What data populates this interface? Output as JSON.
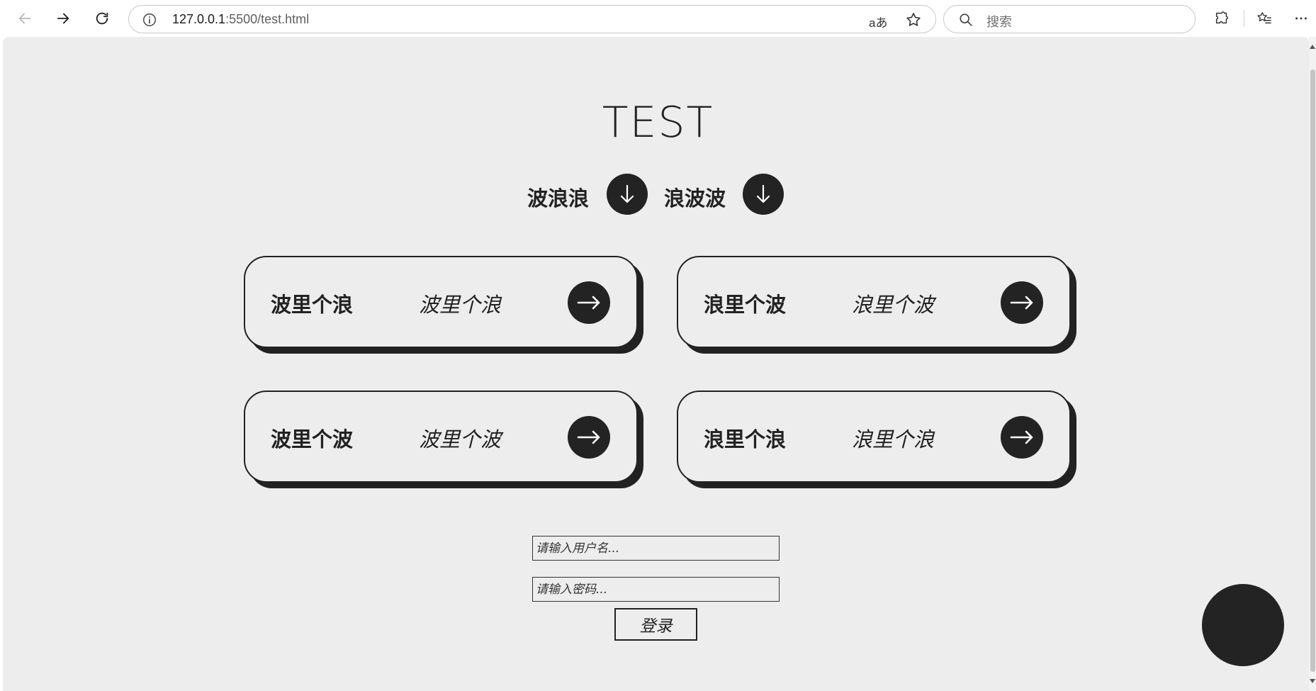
{
  "browser": {
    "url_host": "127.0.0.1",
    "url_rest": ":5500/test.html",
    "read_aloud_label": "aあ",
    "search_placeholder": "搜索"
  },
  "page": {
    "title": "TEST",
    "wave_buttons": [
      {
        "label": "波浪浪",
        "icon": "arrow-down-icon"
      },
      {
        "label": "浪波波",
        "icon": "arrow-down-icon"
      }
    ],
    "cards": [
      {
        "bold": "波里个浪",
        "italic": "波里个浪",
        "icon": "arrow-right-icon"
      },
      {
        "bold": "浪里个波",
        "italic": "浪里个波",
        "icon": "arrow-right-icon"
      },
      {
        "bold": "波里个波",
        "italic": "波里个波",
        "icon": "arrow-right-icon"
      },
      {
        "bold": "浪里个浪",
        "italic": "浪里个浪",
        "icon": "arrow-right-icon"
      }
    ],
    "form": {
      "username_placeholder": "请输入用户名...",
      "password_placeholder": "请输入密码...",
      "login_label": "登录"
    }
  },
  "colors": {
    "page_bg": "#ededed",
    "dark": "#232323"
  }
}
